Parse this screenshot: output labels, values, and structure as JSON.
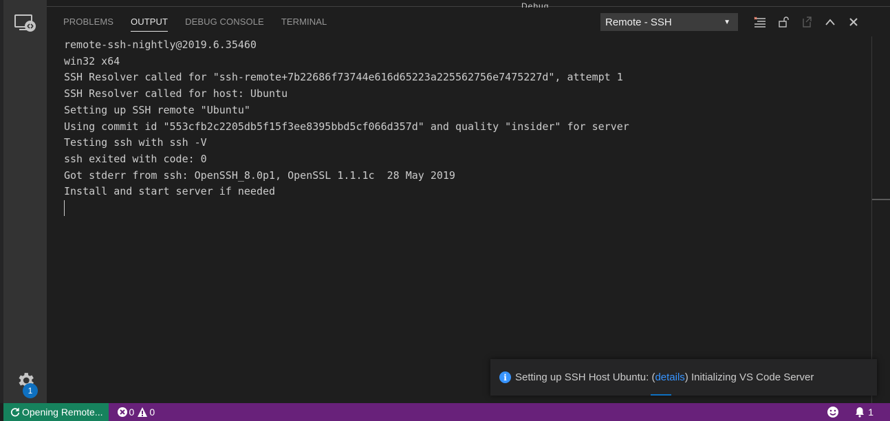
{
  "top_remnant": "Debug...",
  "panel": {
    "tabs": [
      {
        "label": "PROBLEMS",
        "active": false
      },
      {
        "label": "OUTPUT",
        "active": true
      },
      {
        "label": "DEBUG CONSOLE",
        "active": false
      },
      {
        "label": "TERMINAL",
        "active": false
      }
    ],
    "output_channel": "Remote - SSH",
    "output_lines": [
      "remote-ssh-nightly@2019.6.35460",
      "win32 x64",
      "SSH Resolver called for \"ssh-remote+7b22686f73744e616d65223a225562756e7475227d\", attempt 1",
      "SSH Resolver called for host: Ubuntu",
      "Setting up SSH remote \"Ubuntu\"",
      "Using commit id \"553cfb2c2205db5f15f3ee8395bbd5cf066d357d\" and quality \"insider\" for server",
      "Testing ssh with ssh -V",
      "ssh exited with code: 0",
      "Got stderr from ssh: OpenSSH_8.0p1, OpenSSL 1.1.1c  28 May 2019",
      "Install and start server if needed"
    ]
  },
  "activity": {
    "settings_badge": "1"
  },
  "notification": {
    "text_before": "Setting up SSH Host Ubuntu: (",
    "link": "details",
    "text_after": ") Initializing VS Code Server"
  },
  "status_bar": {
    "remote_label": "Opening Remote...",
    "errors": "0",
    "warnings": "0",
    "notifications": "1"
  },
  "colors": {
    "status_bar": "#68217a",
    "remote_indicator": "#16825d",
    "link": "#3794ff"
  }
}
